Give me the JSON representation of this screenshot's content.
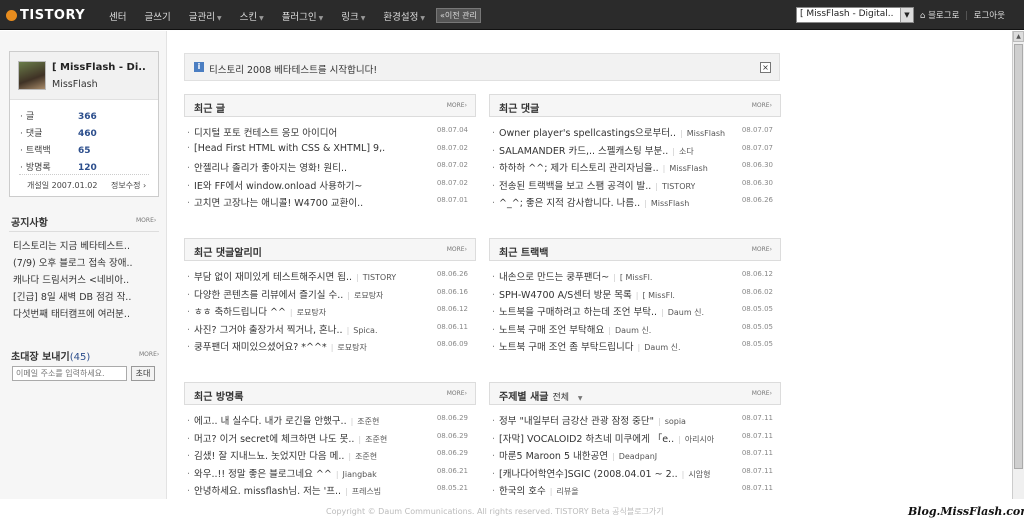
{
  "topbar": {
    "logo": "TISTORY",
    "nav": [
      "센터",
      "글쓰기",
      "글관리",
      "스킨",
      "플러그인",
      "링크",
      "환경설정"
    ],
    "prev_admin": "«이전 관리",
    "blog_select": "[ MissFlash - Digital..",
    "links": [
      "블로그로",
      "로그아웃"
    ]
  },
  "profile": {
    "name": "[ MissFlash - Di..",
    "sub": "MissFlash",
    "stats": [
      {
        "label": "글",
        "value": "366"
      },
      {
        "label": "댓글",
        "value": "460"
      },
      {
        "label": "트랙백",
        "value": "65"
      },
      {
        "label": "방명록",
        "value": "120"
      }
    ],
    "open_date": "개설일 2007.01.02",
    "info_edit": "정보수정 ›"
  },
  "notices": {
    "title": "공지사항",
    "more": "MORE›",
    "items": [
      "티스토리는 지금 베타테스트..",
      "(7/9) 오후 블로그 접속 장애..",
      "캐나다 드림서커스 <네비아..",
      "[긴급] 8일 새벽 DB 점검 작..",
      "다섯번째 태터캠프에 여러분.."
    ]
  },
  "invite": {
    "title": "초대장 보내기",
    "count": "(45)",
    "more": "MORE›",
    "placeholder": "이메일 주소를 입력하세요.",
    "button": "초대"
  },
  "banner": {
    "text": "티스토리 2008 베타테스트를 시작합니다!"
  },
  "recent_posts": {
    "title": "최근 글",
    "more": "MORE›",
    "rows": [
      {
        "t": "디지털 포토 컨테스트 응모 아이디어",
        "d": "08.07.04"
      },
      {
        "t": "[Head First HTML with CSS & XHTML] 9,.",
        "d": "08.07.02"
      },
      {
        "t": "안젤리나 졸리가 좋아지는 영화! 원티..",
        "d": "08.07.02"
      },
      {
        "t": "IE와 FF에서 window.onload 사용하기~",
        "d": "08.07.02"
      },
      {
        "t": "고치면 고장나는 애니콜! W4700 교환이..",
        "d": "08.07.01"
      }
    ]
  },
  "recent_comments": {
    "title": "최근 댓글",
    "more": "MORE›",
    "rows": [
      {
        "t": "Owner player's spellcastings으로부터..",
        "a": "MissFlash",
        "d": "08.07.07"
      },
      {
        "t": "SALAMANDER 카드,.. 스펠캐스팅 부분..",
        "a": "소다",
        "d": "08.07.07"
      },
      {
        "t": "하하하 ^^; 제가 티스토리 관리자님을..",
        "a": "MissFlash",
        "d": "08.06.30"
      },
      {
        "t": "전송된 트랙백을 보고 스팸 공격이 발..",
        "a": "TISTORY",
        "d": "08.06.30"
      },
      {
        "t": "^_^; 좋은 지적 감사합니다. 나름..",
        "a": "MissFlash",
        "d": "08.06.26"
      }
    ]
  },
  "comment_alerts": {
    "title": "최근 댓글알리미",
    "more": "MORE›",
    "rows": [
      {
        "t": "부담 없이 재미있게 테스트해주시면 됩..",
        "a": "TISTORY",
        "d": "08.06.26"
      },
      {
        "t": "다양한 콘텐츠를 리뷰에서 즐기실 수..",
        "a": "로묘탕자",
        "d": "08.06.16"
      },
      {
        "t": "ㅎㅎ 축하드립니다 ^^",
        "a": "로묘탕자",
        "d": "08.06.12"
      },
      {
        "t": "사진? 그거야 출장가서 찍거나, 혼나..",
        "a": "Spica.",
        "d": "08.06.11"
      },
      {
        "t": "쿵푸팬더 재미있으셨어요? *^^*",
        "a": "로묘탕자",
        "d": "08.06.09"
      }
    ]
  },
  "recent_trackbacks": {
    "title": "최근 트랙백",
    "more": "MORE›",
    "rows": [
      {
        "t": "내손으로 만드는 쿵푸팬더~",
        "a": "[ MissFl.",
        "d": "08.06.12"
      },
      {
        "t": "SPH-W4700 A/S센터 방문 목록",
        "a": "[ MissFl.",
        "d": "08.06.02"
      },
      {
        "t": "노트북을 구매하려고 하는데 조언 부탁..",
        "a": "Daum 신.",
        "d": "08.05.05"
      },
      {
        "t": "노트북 구매 조언 부탁해요",
        "a": "Daum 신.",
        "d": "08.05.05"
      },
      {
        "t": "노트북 구매 조언 좀 부탁드립니다",
        "a": "Daum 신.",
        "d": "08.05.05"
      }
    ]
  },
  "recent_guestbook": {
    "title": "최근 방명록",
    "more": "MORE›",
    "rows": [
      {
        "t": "에고.. 내 실수다. 내가 로긴을 안했구..",
        "a": "조준현",
        "d": "08.06.29"
      },
      {
        "t": "머고? 이거 secret에 체크하면 나도 못..",
        "a": "조준현",
        "d": "08.06.29"
      },
      {
        "t": "김샜! 잘 지내느뇨. 놋었지만 다음 메..",
        "a": "조준현",
        "d": "08.06.29"
      },
      {
        "t": "와우..!! 정말 좋은 블로그네요 ^^",
        "a": "Jiangbak",
        "d": "08.06.21"
      },
      {
        "t": "안녕하세요. missflash님. 저는 '프..",
        "a": "프레스빔",
        "d": "08.05.21"
      }
    ]
  },
  "topic_posts": {
    "title": "주제별 새글",
    "filter": "전체",
    "more": "MORE›",
    "rows": [
      {
        "t": "정부 \"내일부터 금강산 관광 잠정 중단\"",
        "a": "sopia",
        "d": "08.07.11"
      },
      {
        "t": "[자막] VOCALOID2 하츠네 미쿠에게 「e..",
        "a": "아리시아",
        "d": "08.07.11"
      },
      {
        "t": "마룬5 Maroon 5 내한공연",
        "a": "DeadpanJ",
        "d": "08.07.11"
      },
      {
        "t": "[캐나다어학연수]SGIC (2008.04.01 ~ 2..",
        "a": "시암형",
        "d": "08.07.11"
      },
      {
        "t": "한국의 호수",
        "a": "리뷰올",
        "d": "08.07.11"
      }
    ]
  },
  "footer": {
    "text": "Copyright © Daum Communications. All rights reserved. TISTORY Beta 공식블로그가기"
  },
  "watermark": "Blog.MissFlash.com",
  "colors": {
    "topbar": "#2b2b2b",
    "logo_dot": "#e78c1e",
    "stat_value": "#2c4e8c",
    "info_icon": "#4b7ec2"
  }
}
